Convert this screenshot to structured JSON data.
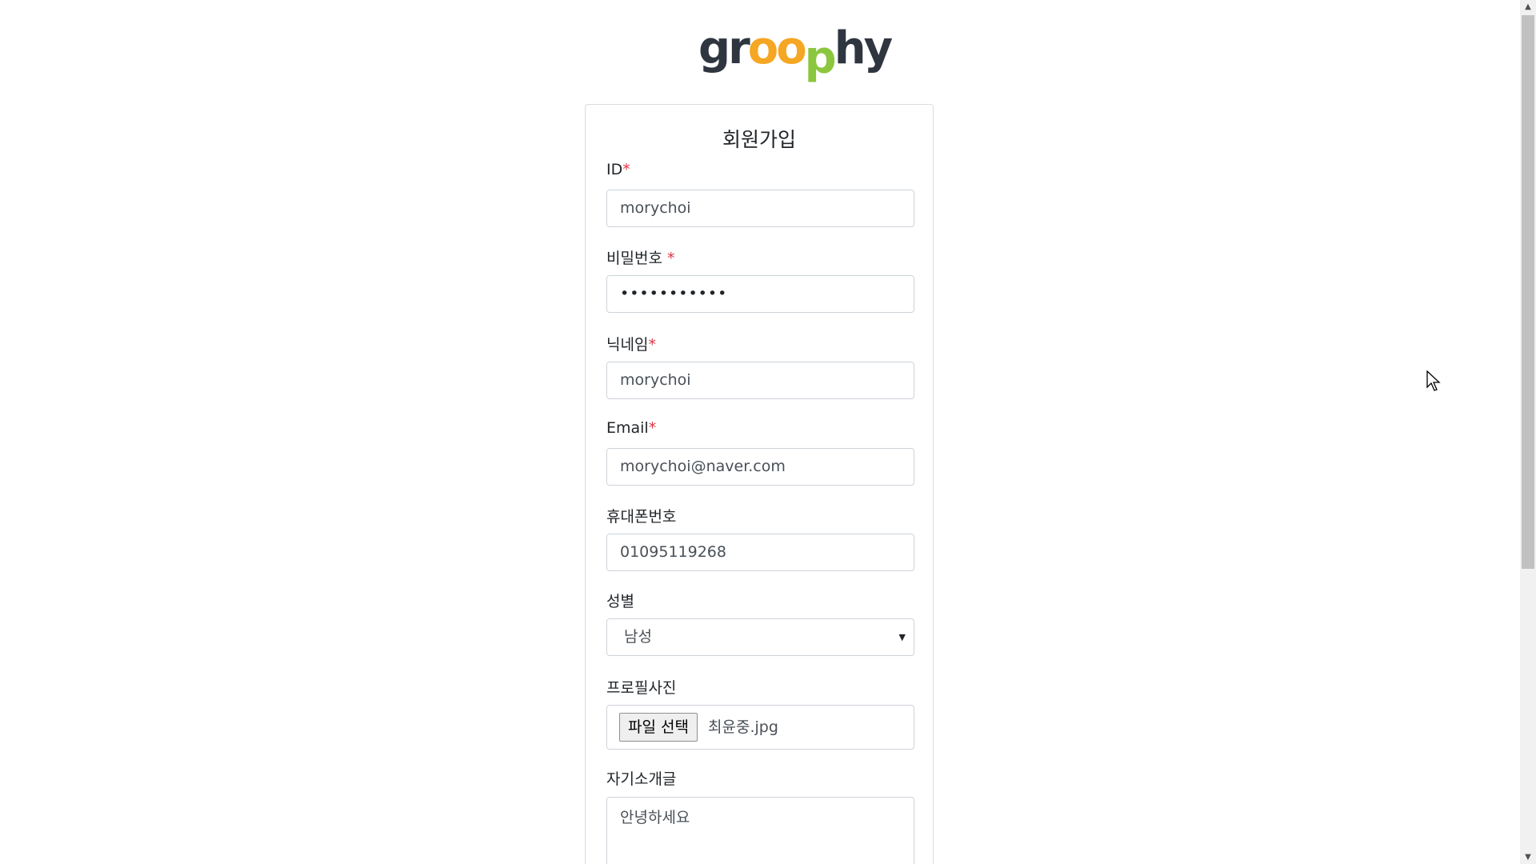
{
  "logo": {
    "part1": "gr",
    "part2": "o",
    "part3": "o",
    "part4": "p",
    "part5": "hy",
    "colors": {
      "dark": "#2f3640",
      "orange": "#f5a623",
      "green": "#8cc63f"
    }
  },
  "form": {
    "title": "회원가입",
    "id": {
      "label": "ID",
      "required_mark": "*",
      "value": "morychoi"
    },
    "password": {
      "label": "비밀번호 ",
      "required_mark": "*",
      "value": "•••••••••••"
    },
    "nickname": {
      "label": "닉네임",
      "required_mark": "*",
      "value": "morychoi"
    },
    "email": {
      "label": "Email",
      "required_mark": "*",
      "value": "morychoi@naver.com"
    },
    "phone": {
      "label": "휴대폰번호",
      "value": "01095119268"
    },
    "gender": {
      "label": "성별",
      "selected": "남성",
      "arrow": "▼"
    },
    "profile_photo": {
      "label": "프로필사진",
      "button_label": "파일 선택",
      "file_name": "최윤중.jpg"
    },
    "intro": {
      "label": "자기소개글",
      "value": "안녕하세요"
    }
  },
  "scrollbar": {
    "up_arrow": "▲",
    "down_arrow": "▼"
  },
  "colors": {
    "required": "#dc3545",
    "border": "#ced4da",
    "card_border": "#d9dcdf"
  }
}
